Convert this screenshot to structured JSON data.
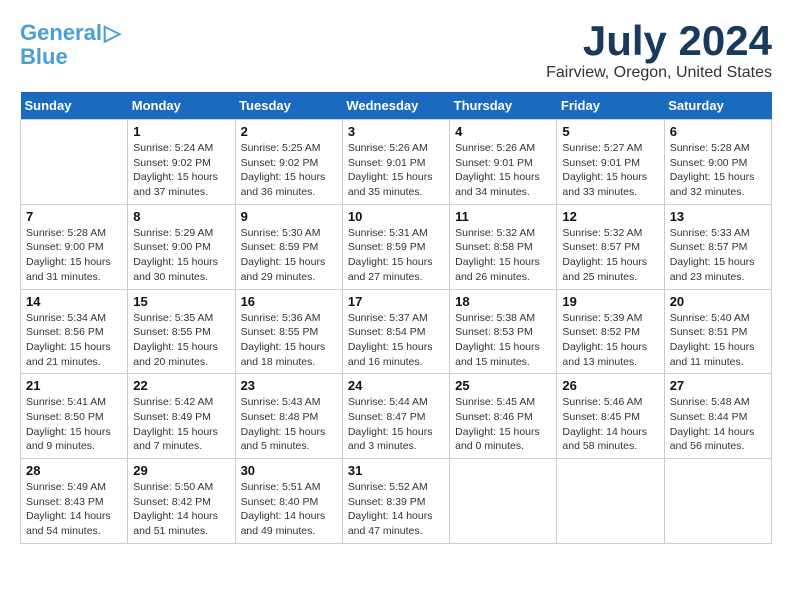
{
  "header": {
    "logo_line1": "General",
    "logo_line2": "Blue",
    "month": "July 2024",
    "location": "Fairview, Oregon, United States"
  },
  "days_of_week": [
    "Sunday",
    "Monday",
    "Tuesday",
    "Wednesday",
    "Thursday",
    "Friday",
    "Saturday"
  ],
  "weeks": [
    [
      {
        "day": "",
        "info": ""
      },
      {
        "day": "1",
        "info": "Sunrise: 5:24 AM\nSunset: 9:02 PM\nDaylight: 15 hours\nand 37 minutes."
      },
      {
        "day": "2",
        "info": "Sunrise: 5:25 AM\nSunset: 9:02 PM\nDaylight: 15 hours\nand 36 minutes."
      },
      {
        "day": "3",
        "info": "Sunrise: 5:26 AM\nSunset: 9:01 PM\nDaylight: 15 hours\nand 35 minutes."
      },
      {
        "day": "4",
        "info": "Sunrise: 5:26 AM\nSunset: 9:01 PM\nDaylight: 15 hours\nand 34 minutes."
      },
      {
        "day": "5",
        "info": "Sunrise: 5:27 AM\nSunset: 9:01 PM\nDaylight: 15 hours\nand 33 minutes."
      },
      {
        "day": "6",
        "info": "Sunrise: 5:28 AM\nSunset: 9:00 PM\nDaylight: 15 hours\nand 32 minutes."
      }
    ],
    [
      {
        "day": "7",
        "info": "Sunrise: 5:28 AM\nSunset: 9:00 PM\nDaylight: 15 hours\nand 31 minutes."
      },
      {
        "day": "8",
        "info": "Sunrise: 5:29 AM\nSunset: 9:00 PM\nDaylight: 15 hours\nand 30 minutes."
      },
      {
        "day": "9",
        "info": "Sunrise: 5:30 AM\nSunset: 8:59 PM\nDaylight: 15 hours\nand 29 minutes."
      },
      {
        "day": "10",
        "info": "Sunrise: 5:31 AM\nSunset: 8:59 PM\nDaylight: 15 hours\nand 27 minutes."
      },
      {
        "day": "11",
        "info": "Sunrise: 5:32 AM\nSunset: 8:58 PM\nDaylight: 15 hours\nand 26 minutes."
      },
      {
        "day": "12",
        "info": "Sunrise: 5:32 AM\nSunset: 8:57 PM\nDaylight: 15 hours\nand 25 minutes."
      },
      {
        "day": "13",
        "info": "Sunrise: 5:33 AM\nSunset: 8:57 PM\nDaylight: 15 hours\nand 23 minutes."
      }
    ],
    [
      {
        "day": "14",
        "info": "Sunrise: 5:34 AM\nSunset: 8:56 PM\nDaylight: 15 hours\nand 21 minutes."
      },
      {
        "day": "15",
        "info": "Sunrise: 5:35 AM\nSunset: 8:55 PM\nDaylight: 15 hours\nand 20 minutes."
      },
      {
        "day": "16",
        "info": "Sunrise: 5:36 AM\nSunset: 8:55 PM\nDaylight: 15 hours\nand 18 minutes."
      },
      {
        "day": "17",
        "info": "Sunrise: 5:37 AM\nSunset: 8:54 PM\nDaylight: 15 hours\nand 16 minutes."
      },
      {
        "day": "18",
        "info": "Sunrise: 5:38 AM\nSunset: 8:53 PM\nDaylight: 15 hours\nand 15 minutes."
      },
      {
        "day": "19",
        "info": "Sunrise: 5:39 AM\nSunset: 8:52 PM\nDaylight: 15 hours\nand 13 minutes."
      },
      {
        "day": "20",
        "info": "Sunrise: 5:40 AM\nSunset: 8:51 PM\nDaylight: 15 hours\nand 11 minutes."
      }
    ],
    [
      {
        "day": "21",
        "info": "Sunrise: 5:41 AM\nSunset: 8:50 PM\nDaylight: 15 hours\nand 9 minutes."
      },
      {
        "day": "22",
        "info": "Sunrise: 5:42 AM\nSunset: 8:49 PM\nDaylight: 15 hours\nand 7 minutes."
      },
      {
        "day": "23",
        "info": "Sunrise: 5:43 AM\nSunset: 8:48 PM\nDaylight: 15 hours\nand 5 minutes."
      },
      {
        "day": "24",
        "info": "Sunrise: 5:44 AM\nSunset: 8:47 PM\nDaylight: 15 hours\nand 3 minutes."
      },
      {
        "day": "25",
        "info": "Sunrise: 5:45 AM\nSunset: 8:46 PM\nDaylight: 15 hours\nand 0 minutes."
      },
      {
        "day": "26",
        "info": "Sunrise: 5:46 AM\nSunset: 8:45 PM\nDaylight: 14 hours\nand 58 minutes."
      },
      {
        "day": "27",
        "info": "Sunrise: 5:48 AM\nSunset: 8:44 PM\nDaylight: 14 hours\nand 56 minutes."
      }
    ],
    [
      {
        "day": "28",
        "info": "Sunrise: 5:49 AM\nSunset: 8:43 PM\nDaylight: 14 hours\nand 54 minutes."
      },
      {
        "day": "29",
        "info": "Sunrise: 5:50 AM\nSunset: 8:42 PM\nDaylight: 14 hours\nand 51 minutes."
      },
      {
        "day": "30",
        "info": "Sunrise: 5:51 AM\nSunset: 8:40 PM\nDaylight: 14 hours\nand 49 minutes."
      },
      {
        "day": "31",
        "info": "Sunrise: 5:52 AM\nSunset: 8:39 PM\nDaylight: 14 hours\nand 47 minutes."
      },
      {
        "day": "",
        "info": ""
      },
      {
        "day": "",
        "info": ""
      },
      {
        "day": "",
        "info": ""
      }
    ]
  ]
}
